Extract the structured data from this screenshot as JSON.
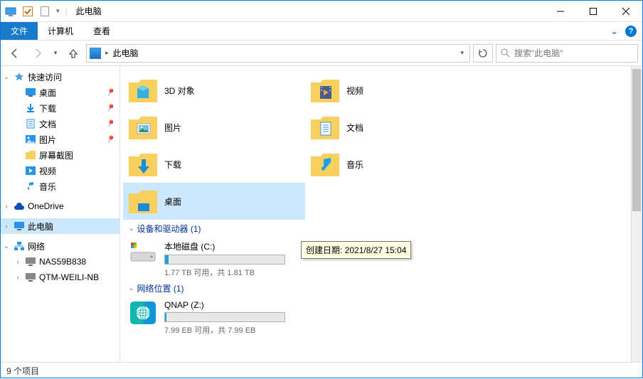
{
  "window": {
    "title": "此电脑",
    "qat_separator": "|"
  },
  "ribbon": {
    "tabs": {
      "file": "文件",
      "computer": "计算机",
      "view": "查看"
    }
  },
  "nav": {
    "address": "此电脑",
    "search_placeholder": "搜索\"此电脑\""
  },
  "sidebar": {
    "quick_access": "快速访问",
    "desktop": "桌面",
    "downloads": "下载",
    "documents": "文档",
    "pictures": "图片",
    "screenshots": "屏幕截图",
    "videos": "视频",
    "music": "音乐",
    "onedrive": "OneDrive",
    "this_pc": "此电脑",
    "network": "网络",
    "nas": "NAS59B838",
    "qtm": "QTM-WEILI-NB"
  },
  "content": {
    "folders": {
      "objects3d": "3D 对象",
      "videos": "视频",
      "pictures": "图片",
      "documents": "文档",
      "downloads": "下载",
      "music": "音乐",
      "desktop": "桌面"
    },
    "tooltip": "创建日期: 2021/8/27 15:04",
    "section_devices": "设备和驱动器 (1)",
    "drive_c": {
      "name": "本地磁盘 (C:)",
      "fill_pct": 3,
      "sub": "1.77 TB 可用，共 1.81 TB"
    },
    "section_network": "网络位置 (1)",
    "drive_z": {
      "name": "QNAP (Z:)",
      "fill_pct": 1,
      "sub": "7.99 EB 可用，共 7.99 EB"
    }
  },
  "status": {
    "text": "9 个项目"
  }
}
